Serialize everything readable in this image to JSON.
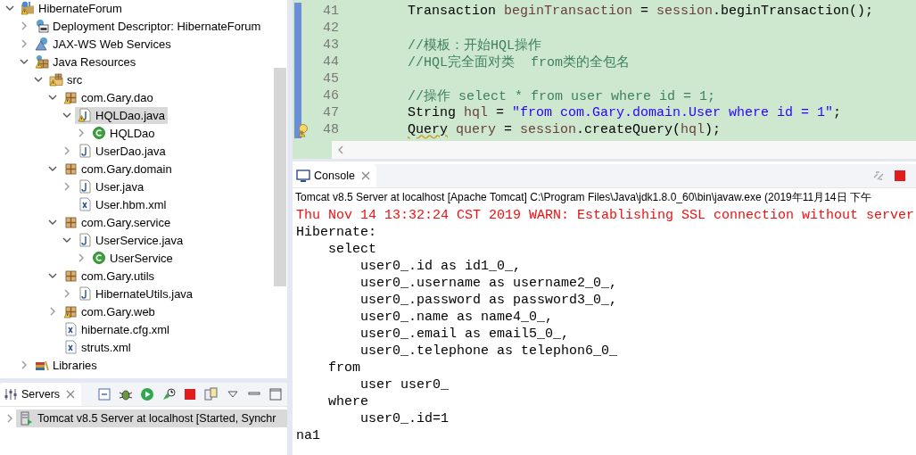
{
  "project_tree": {
    "items": [
      {
        "label": "HibernateForum",
        "kind": "project",
        "expanded": true,
        "selected": false,
        "warning": true,
        "children": [
          {
            "label": "Deployment Descriptor: HibernateForum",
            "kind": "descriptor",
            "expanded": false,
            "selected": false,
            "warning": false
          },
          {
            "label": "JAX-WS Web Services",
            "kind": "webservices",
            "expanded": false,
            "selected": false,
            "warning": false
          },
          {
            "label": "Java Resources",
            "kind": "resources",
            "expanded": true,
            "selected": false,
            "warning": true,
            "children": [
              {
                "label": "src",
                "kind": "srcfolder",
                "expanded": true,
                "selected": false,
                "warning": true,
                "children": [
                  {
                    "label": "com.Gary.dao",
                    "kind": "package",
                    "expanded": true,
                    "selected": false,
                    "warning": true,
                    "children": [
                      {
                        "label": "HQLDao.java",
                        "kind": "java",
                        "expanded": true,
                        "selected": true,
                        "warning": true,
                        "children": [
                          {
                            "label": "HQLDao",
                            "kind": "class",
                            "expanded": false,
                            "selected": false,
                            "warning": false
                          }
                        ]
                      },
                      {
                        "label": "UserDao.java",
                        "kind": "java",
                        "expanded": false,
                        "selected": false,
                        "warning": false
                      }
                    ]
                  },
                  {
                    "label": "com.Gary.domain",
                    "kind": "package",
                    "expanded": true,
                    "selected": false,
                    "warning": false,
                    "children": [
                      {
                        "label": "User.java",
                        "kind": "java",
                        "expanded": false,
                        "selected": false,
                        "warning": false
                      },
                      {
                        "label": "User.hbm.xml",
                        "kind": "xml",
                        "selected": false,
                        "warning": false
                      }
                    ]
                  },
                  {
                    "label": "com.Gary.service",
                    "kind": "package",
                    "expanded": true,
                    "selected": false,
                    "warning": false,
                    "children": [
                      {
                        "label": "UserService.java",
                        "kind": "java",
                        "expanded": true,
                        "selected": false,
                        "warning": false,
                        "children": [
                          {
                            "label": "UserService",
                            "kind": "class",
                            "expanded": false,
                            "selected": false,
                            "warning": false
                          }
                        ]
                      }
                    ]
                  },
                  {
                    "label": "com.Gary.utils",
                    "kind": "package",
                    "expanded": true,
                    "selected": false,
                    "warning": false,
                    "children": [
                      {
                        "label": "HibernateUtils.java",
                        "kind": "java",
                        "expanded": false,
                        "selected": false,
                        "warning": false
                      }
                    ]
                  },
                  {
                    "label": "com.Gary.web",
                    "kind": "package",
                    "expanded": false,
                    "selected": false,
                    "warning": true
                  },
                  {
                    "label": "hibernate.cfg.xml",
                    "kind": "xml",
                    "selected": false,
                    "warning": false
                  },
                  {
                    "label": "struts.xml",
                    "kind": "xml",
                    "selected": false,
                    "warning": false
                  }
                ]
              }
            ]
          },
          {
            "label": "Libraries",
            "kind": "libraries",
            "expanded": false,
            "selected": false,
            "warning": false
          }
        ]
      }
    ]
  },
  "servers_view": {
    "tab": "Servers",
    "rows": [
      {
        "label": "Tomcat v8.5 Server at localhost  [Started, Synchr",
        "expanded": false,
        "selected": true
      }
    ]
  },
  "editor": {
    "lines": [
      {
        "number": "41",
        "warning": false,
        "segments": [
          {
            "kind": "plain",
            "text": "Transaction "
          },
          {
            "kind": "var",
            "text": "beginTransaction"
          },
          {
            "kind": "plain",
            "text": " = "
          },
          {
            "kind": "var",
            "text": "session"
          },
          {
            "kind": "plain",
            "text": ".beginTransaction();"
          }
        ]
      },
      {
        "number": "42",
        "warning": false
      },
      {
        "number": "43",
        "warning": false,
        "segments": [
          {
            "kind": "comment",
            "text": "//模板：开始HQL操作"
          }
        ]
      },
      {
        "number": "44",
        "warning": false,
        "segments": [
          {
            "kind": "comment",
            "text": "//HQL完全面对类  from类的全包名"
          }
        ]
      },
      {
        "number": "45",
        "warning": false
      },
      {
        "number": "46",
        "warning": false,
        "segments": [
          {
            "kind": "comment",
            "text": "//操作 select * from user where id = 1;"
          }
        ]
      },
      {
        "number": "47",
        "warning": false,
        "segments": [
          {
            "kind": "plain",
            "text": "String "
          },
          {
            "kind": "var",
            "text": "hql"
          },
          {
            "kind": "plain",
            "text": " = "
          },
          {
            "kind": "string",
            "text": "\"from com.Gary.domain.User where id = 1\""
          },
          {
            "kind": "plain",
            "text": ";"
          }
        ]
      },
      {
        "number": "48",
        "warning": true,
        "segments": [
          {
            "kind": "squiggle",
            "text": "Query"
          },
          {
            "kind": "var",
            "text": " query"
          },
          {
            "kind": "plain",
            "text": " = "
          },
          {
            "kind": "var",
            "text": "session"
          },
          {
            "kind": "plain",
            "text": ".createQuery("
          },
          {
            "kind": "var",
            "text": "hql"
          },
          {
            "kind": "plain",
            "text": ");"
          }
        ]
      }
    ]
  },
  "console": {
    "tab": "Console",
    "header": "Tomcat v8.5 Server at localhost [Apache Tomcat] C:\\Program Files\\Java\\jdk1.8.0_60\\bin\\javaw.exe (2019年11月14日 下午",
    "lines": [
      {
        "kind": "error",
        "text": "Thu Nov 14 13:32:24 CST 2019 WARN: Establishing SSL connection without server"
      },
      {
        "kind": "out",
        "text": "Hibernate: "
      },
      {
        "kind": "out",
        "text": "    select"
      },
      {
        "kind": "out",
        "text": "        user0_.id as id1_0_,"
      },
      {
        "kind": "out",
        "text": "        user0_.username as username2_0_,"
      },
      {
        "kind": "out",
        "text": "        user0_.password as password3_0_,"
      },
      {
        "kind": "out",
        "text": "        user0_.name as name4_0_,"
      },
      {
        "kind": "out",
        "text": "        user0_.email as email5_0_,"
      },
      {
        "kind": "out",
        "text": "        user0_.telephone as telephon6_0_ "
      },
      {
        "kind": "out",
        "text": "    from"
      },
      {
        "kind": "out",
        "text": "        user user0_ "
      },
      {
        "kind": "out",
        "text": "    where"
      },
      {
        "kind": "out",
        "text": "        user0_.id=1"
      },
      {
        "kind": "out",
        "text": "na1"
      }
    ]
  }
}
